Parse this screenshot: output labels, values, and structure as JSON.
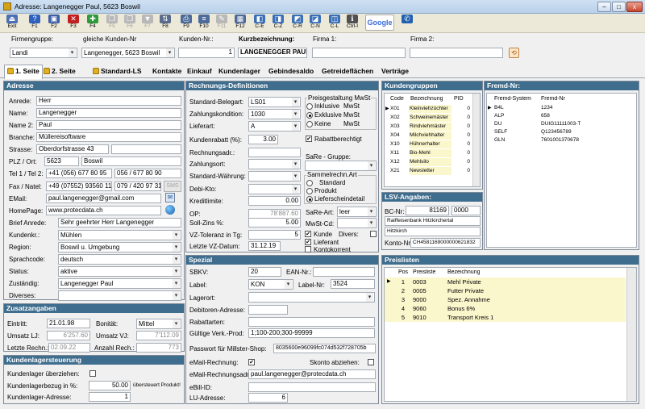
{
  "window": {
    "title": "Adresse: Langenegger Paul, 5623 Boswil",
    "min": "–",
    "max": "□",
    "close": "x"
  },
  "toolbar": [
    {
      "label": "Exit",
      "icon": "exit-icon",
      "color": "#4a6fb5",
      "glyph": "⏏",
      "enabled": true
    },
    {
      "label": "F1",
      "icon": "help-icon",
      "color": "#2f62c0",
      "glyph": "?",
      "enabled": true
    },
    {
      "label": "F2",
      "icon": "save-icon",
      "color": "#3d5fa8",
      "glyph": "▣",
      "enabled": true
    },
    {
      "label": "F3",
      "icon": "delete-icon",
      "color": "#c02020",
      "glyph": "✕",
      "enabled": true
    },
    {
      "label": "F4",
      "icon": "new-icon",
      "color": "#2e9a3a",
      "glyph": "✚",
      "enabled": true
    },
    {
      "label": "F5",
      "icon": "copy-icon",
      "color": "#b8b8b8",
      "glyph": "❐",
      "enabled": false
    },
    {
      "label": "F6",
      "icon": "paste-icon",
      "color": "#b8b8b8",
      "glyph": "❐",
      "enabled": false
    },
    {
      "label": "F7",
      "icon": "filter-icon",
      "color": "#b8b8b8",
      "glyph": "▼",
      "enabled": false
    },
    {
      "label": "F8",
      "icon": "sort-icon",
      "color": "#5a6c8c",
      "glyph": "⇅",
      "enabled": true
    },
    {
      "label": "F9",
      "icon": "print-icon",
      "color": "#4c6a9a",
      "glyph": "⎙",
      "enabled": true
    },
    {
      "label": "F10",
      "icon": "list-icon",
      "color": "#4c6a9a",
      "glyph": "≡",
      "enabled": true
    },
    {
      "label": "F11",
      "icon": "edit-icon",
      "color": "#b8b8b8",
      "glyph": "✎",
      "enabled": false
    },
    {
      "label": "F12",
      "icon": "table-icon",
      "color": "#4c6a9a",
      "glyph": "▦",
      "enabled": true
    },
    {
      "label": "C-E",
      "icon": "record-edit-icon",
      "color": "#3a70b8",
      "glyph": "◧",
      "enabled": true
    },
    {
      "label": "C-Z",
      "icon": "record-undo-icon",
      "color": "#3a70b8",
      "glyph": "◨",
      "enabled": true
    },
    {
      "label": "C-R",
      "icon": "record-refresh-icon",
      "color": "#3a70b8",
      "glyph": "◩",
      "enabled": true
    },
    {
      "label": "C-N",
      "icon": "record-next-icon",
      "color": "#3a70b8",
      "glyph": "◪",
      "enabled": true
    },
    {
      "label": "C-L",
      "icon": "record-last-icon",
      "color": "#3a70b8",
      "glyph": "◫",
      "enabled": true
    },
    {
      "label": "Ctrl-I",
      "icon": "info-icon",
      "color": "#505050",
      "glyph": "ℹ",
      "enabled": true
    },
    {
      "label": "Google",
      "icon": "google-search-icon",
      "color": "#ffffff",
      "glyph": "",
      "enabled": true
    },
    {
      "label": "",
      "icon": "phone-icon",
      "color": "#2060b0",
      "glyph": "✆",
      "enabled": true
    }
  ],
  "header": {
    "firmengruppe_label": "Firmengruppe:",
    "firmengruppe": "Landi",
    "gleiche_label": "gleiche Kunden-Nr",
    "gleiche": "Langenegger, 5623 Boswil",
    "kundennr_label": "Kunden-Nr.:",
    "kundennr": "1",
    "kurz_label": "Kurzbezeichnung:",
    "kurz": "LANGENEGGER PAUL",
    "firma1_label": "Firma 1:",
    "firma1": "",
    "firma2_label": "Firma 2:",
    "firma2": ""
  },
  "tabs": [
    "1. Seite",
    "2. Seite",
    "Standard-LS",
    "Kontakte",
    "Einkauf",
    "Kundenlager",
    "Gebindesaldo",
    "Getreideflächen",
    "Verträge"
  ],
  "adresse": {
    "title": "Adresse",
    "anrede_l": "Anrede:",
    "anrede": "Herr",
    "name_l": "Name:",
    "name": "Langenegger",
    "name2_l": "Name 2:",
    "name2": "Paul",
    "branche_l": "Branche:",
    "branche": "Müllereisoftware",
    "strasse_l": "Strasse:",
    "strasse": "Oberdorfstrasse 43",
    "strasse2": "",
    "plz_l": "PLZ / Ort:",
    "plz": "5623",
    "ort": "Boswil",
    "tel_l": "Tel 1 / Tel 2:",
    "tel1": "+41 (056) 677 80 95",
    "tel2": "056 / 677 80 90",
    "fax_l": "Fax / Natel:",
    "fax": "+49 (07552) 93560 11",
    "natel": "079 / 420 97 31",
    "sms": "SMS",
    "email_l": "EMail:",
    "email": "paul.langenegger@gmail.com",
    "homepage_l": "HomePage:",
    "homepage": "www.protecdata.ch",
    "brief_l": "Brief Anrede:",
    "brief": "Sehr geehrter Herr Langenegger",
    "kundenkr_l": "Kundenkr.:",
    "kundenkr": "Mühlen",
    "region_l": "Region:",
    "region": "Boswil u. Umgebung",
    "sprache_l": "Sprachcode:",
    "sprache": "deutsch",
    "status_l": "Status:",
    "status": "aktive",
    "zustaendig_l": "Zuständig:",
    "zustaendig": "Langenegger Paul",
    "diverses_l": "Diverses:",
    "diverses": ""
  },
  "zusatz": {
    "title": "Zusatzangaben",
    "eintritt_l": "Eintritt:",
    "eintritt": "21.01.98",
    "bonitaet_l": "Bonität:",
    "bonitaet": "Mittel",
    "umsatzlj_l": "Umsatz LJ:",
    "umsatzlj": "6'257.60",
    "umsatzvj_l": "Umsatz VJ:",
    "umsatzvj": "7'112.09",
    "letzte_l": "Letzte Rechn.:",
    "letzte": "02.09.22",
    "anzahl_l": "Anzahl Rech.:",
    "anzahl": "773"
  },
  "kundenlager": {
    "title": "Kundenlagersteuerung",
    "ueberziehen_l": "Kundenlager überziehen:",
    "bezug_l": "Kundenlagerbezug in %:",
    "bezug": "50.00",
    "uebersteuert": "übersteuert Produkt!",
    "adresse_l": "Kundenlager-Adresse:",
    "adresse": "1"
  },
  "rechnung": {
    "title": "Rechnungs-Definitionen",
    "beleg_l": "Standard-Belegart:",
    "beleg": "LS01",
    "zk_l": "Zahlungskondition:",
    "zk": "1030",
    "lieferart_l": "Lieferart:",
    "lieferart": "A",
    "rabatt_l": "Kundenrabatt (%):",
    "rabatt": "3.00",
    "rechadr_l": "Rechnungsadr.:",
    "rechadr": "",
    "zahlungsort_l": "Zahlungsort:",
    "zahlungsort": "",
    "waehrung_l": "Standard-Währung:",
    "waehrung": "",
    "debi_l": "Debi-Kto:",
    "debi": "",
    "kredit_l": "Kreditlimite:",
    "kredit": "0.00",
    "op_l": "OP:",
    "op": "78'887.60",
    "soll_l": "Soll-Zins %:",
    "soll": "5.00",
    "vz_l": "VZ-Toleranz in Tg:",
    "vz": "5",
    "letzte_vz_l": "Letzte VZ-Datum:",
    "letzte_vz": "31.12.19",
    "mwst_title": "Preisgestaltung MwSt",
    "inkl": "Inklusive",
    "exkl": "Exklusive",
    "keine": "Keine",
    "mwst": "MwSt",
    "rabattber": "Rabattberechtigt",
    "sare_gruppe_l": "SaRe - Gruppe:",
    "sare_gruppe": "",
    "sammel_title": "Sammelrechn.Art",
    "standard": "Standard",
    "produkt": "Produkt",
    "lieferschein": "Lieferscheindetail",
    "sare_art_l": "SaRe-Art:",
    "sare_art": "leer",
    "mwst_cd_l": "MwSt-Cd:",
    "mwst_cd": "",
    "kunde": "Kunde",
    "divers": "Divers:",
    "lieferant": "Lieferant",
    "kontokorrent": "Kontokorrent"
  },
  "spezial": {
    "title": "Spezial",
    "sbkv_l": "SBKV:",
    "sbkv": "20",
    "ean_l": "EAN-Nr.:",
    "ean": "",
    "label_l": "Label:",
    "label": "KON",
    "labelnr_l": "Label-Nr:",
    "labelnr": "3524",
    "lagerort_l": "Lagerort:",
    "lagerort": "",
    "debadr_l": "Debitoren-Adresse:",
    "debadr": "",
    "rabattarten_l": "Rabattarten:",
    "rabattarten": "",
    "gueltig_l": "Gültige Verk.-Prod:",
    "gueltig": "1;100-200;300-99999",
    "passwort_l": "Passwort für Millster-Shop:",
    "passwort": "8035600e96099fc074d532f728705b",
    "emailrech_l": "eMail-Rechnung:",
    "skonto_l": "Skonto abziehen:",
    "emailadr_l": "eMail-Rechnungsadr.",
    "emailadr": "paul.langenegger@protecdata.ch",
    "ebill_l": "eBill-ID:",
    "ebill": "",
    "lu_l": "LU-Adresse:",
    "lu": "6"
  },
  "kundengruppen": {
    "title": "Kundengruppen",
    "headers": [
      "Code",
      "Bezeichnung",
      "PID"
    ],
    "rows": [
      [
        "X01",
        "Kleinviehzüchter",
        "0"
      ],
      [
        "X02",
        "Schweinemäster",
        "0"
      ],
      [
        "X03",
        "Rindviehmäster",
        "0"
      ],
      [
        "X04",
        "Milchviehhalter",
        "0"
      ],
      [
        "X10",
        "Hühnerhalter",
        "0"
      ],
      [
        "X11",
        "Bio-Mehl",
        "0"
      ],
      [
        "X12",
        "Mehlsilo",
        "0"
      ],
      [
        "X21",
        "Newsletter",
        "0"
      ]
    ]
  },
  "lsv": {
    "title": "LSV-Angaben:",
    "bc_l": "BC-Nr:",
    "bc": "81169",
    "bc2": "0000",
    "bank": "Raiffeisenbank Hitzkirchertal",
    "ort": "Hitzkirch",
    "konto_l": "Konto-Nr:",
    "konto": "CH4581169000000621832"
  },
  "fremd": {
    "title": "Fremd-Nr:",
    "headers": [
      "Fremd-System",
      "Fremd-Nr"
    ],
    "rows": [
      [
        "B4L",
        "1234"
      ],
      [
        "ALP",
        "658"
      ],
      [
        "DU",
        "DUIG11111003-T"
      ],
      [
        "SELF",
        "Q123456789"
      ],
      [
        "GLN",
        "7601001370678"
      ]
    ]
  },
  "preislisten": {
    "title": "Preislisten",
    "headers": [
      "Pos",
      "Preisliste",
      "Bezeichnung"
    ],
    "rows": [
      [
        "1",
        "0003",
        "Mehl Private"
      ],
      [
        "2",
        "0005",
        "Futter Private"
      ],
      [
        "3",
        "9000",
        "Spez. Annahme"
      ],
      [
        "4",
        "9060",
        "Bonus 6%"
      ],
      [
        "5",
        "9010",
        "Transport Kreis 1"
      ]
    ]
  }
}
